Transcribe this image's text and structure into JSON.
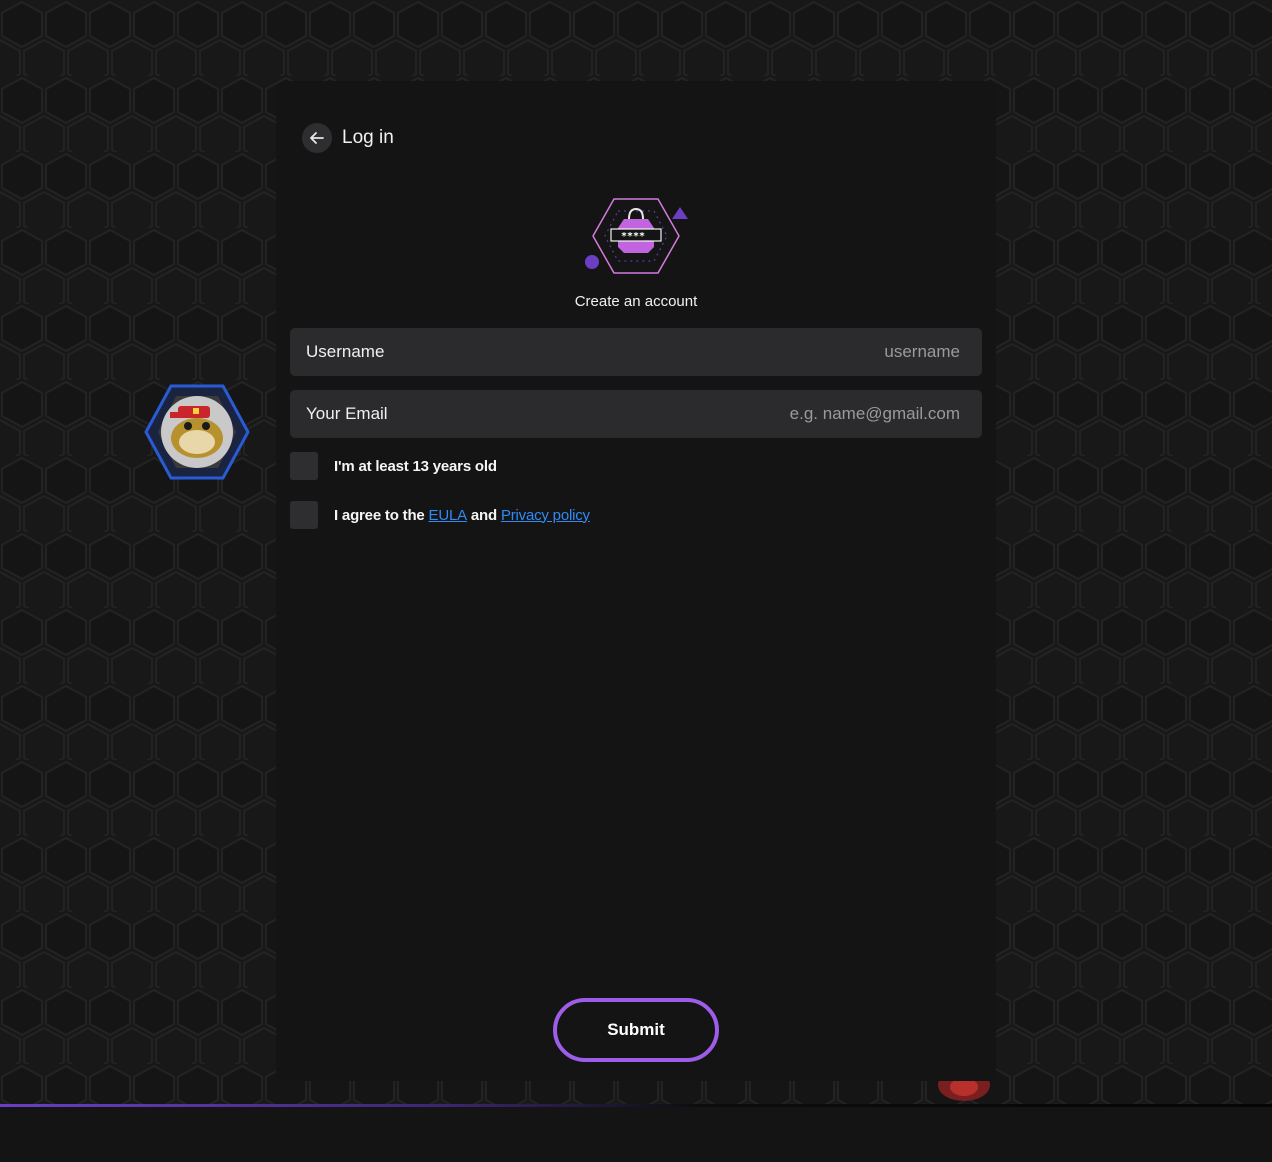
{
  "nav": {
    "back_label": "Log in"
  },
  "form": {
    "title": "Create an account",
    "username": {
      "label": "Username",
      "placeholder": "username",
      "value": ""
    },
    "email": {
      "label": "Your Email",
      "placeholder": "e.g. name@gmail.com",
      "value": ""
    },
    "age_check": {
      "label": "I'm at least 13 years old",
      "checked": false
    },
    "agree_check": {
      "prefix": "I agree to the",
      "eula": "EULA",
      "middle": "and",
      "privacy": "Privacy policy",
      "checked": false
    },
    "submit_label": "Submit"
  },
  "logo": {
    "password_text": "****_"
  },
  "colors": {
    "accent": "#9d5de8",
    "link": "#2f8bf5",
    "panel": "#141414",
    "field": "#2b2b2d"
  },
  "icons": {
    "back": "arrow-left-icon",
    "logo": "lock-password-hexagon-icon",
    "avatar": "frog-avatar-icon"
  }
}
